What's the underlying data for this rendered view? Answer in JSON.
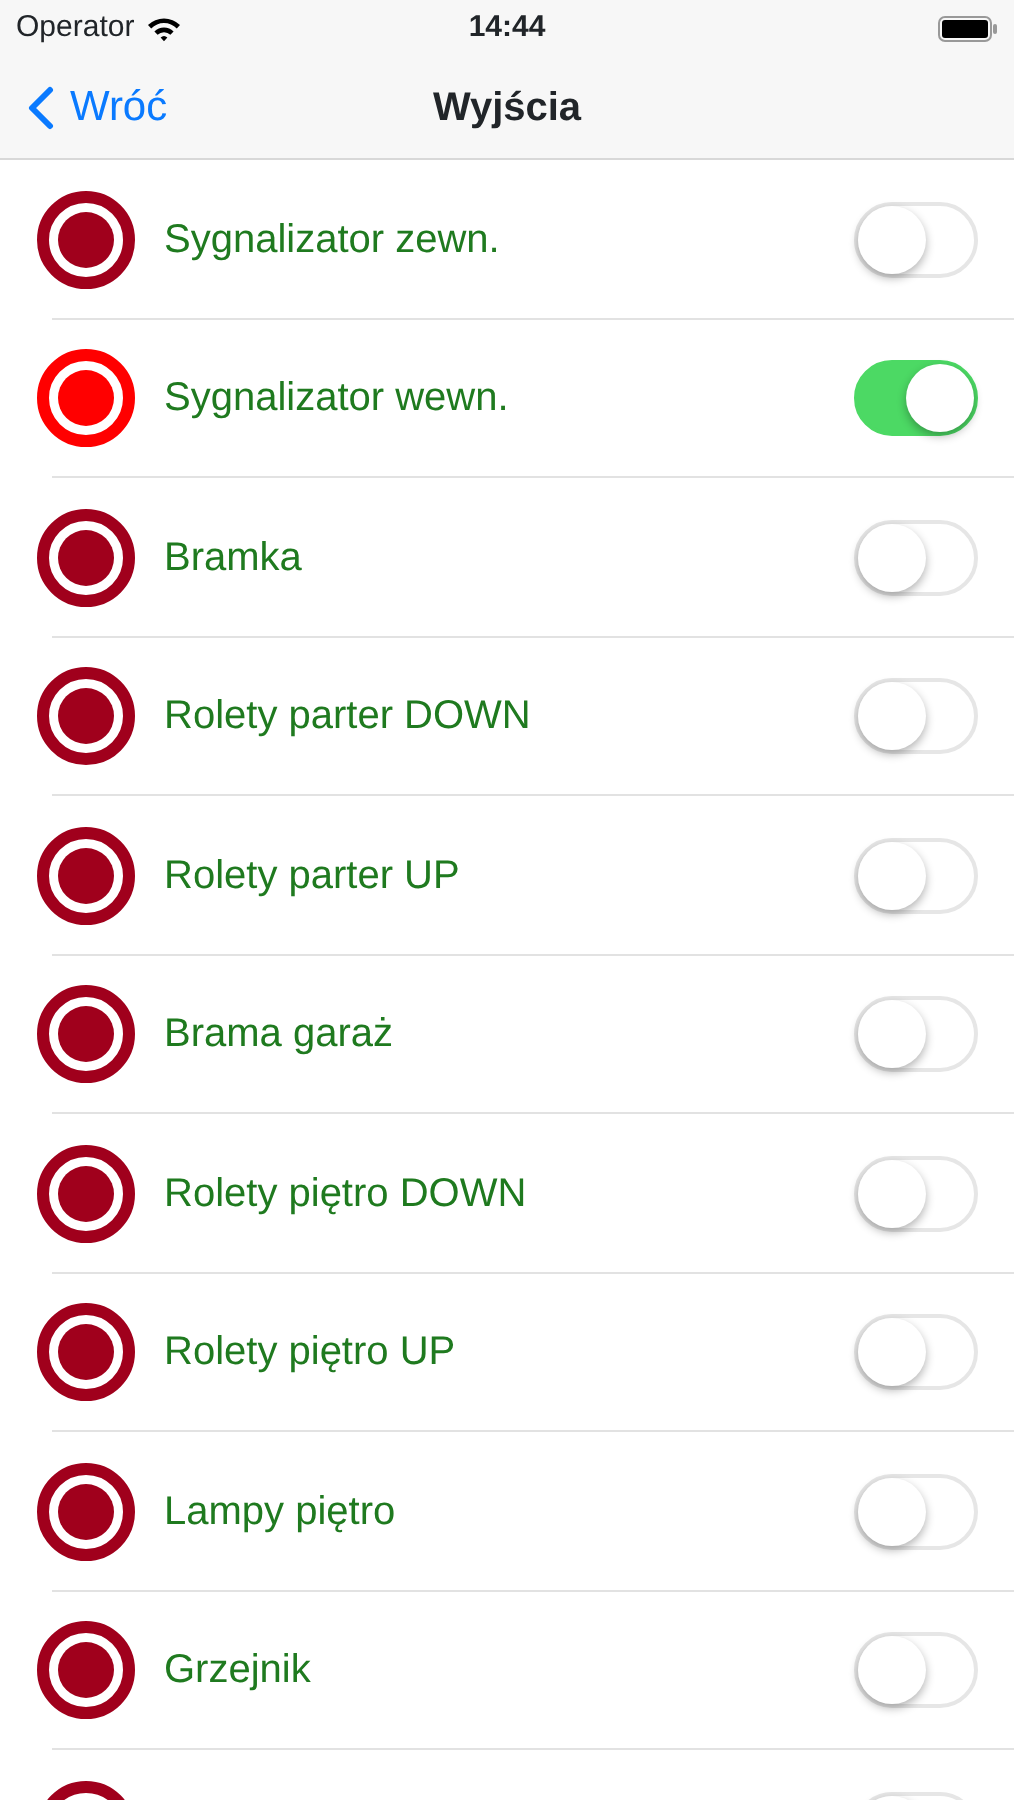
{
  "status_bar": {
    "carrier": "Operator",
    "time": "14:44"
  },
  "nav": {
    "back": "Wróć",
    "title": "Wyjścia"
  },
  "outputs": [
    {
      "label": "Sygnalizator zewn.",
      "on": false
    },
    {
      "label": "Sygnalizator wewn.",
      "on": true
    },
    {
      "label": "Bramka",
      "on": false
    },
    {
      "label": "Rolety parter DOWN",
      "on": false
    },
    {
      "label": "Rolety parter UP",
      "on": false
    },
    {
      "label": "Brama garaż",
      "on": false
    },
    {
      "label": "Rolety piętro DOWN",
      "on": false
    },
    {
      "label": "Rolety piętro UP",
      "on": false
    },
    {
      "label": "Lampy piętro",
      "on": false
    },
    {
      "label": "Grzejnik",
      "on": false
    },
    {
      "on": false
    }
  ]
}
